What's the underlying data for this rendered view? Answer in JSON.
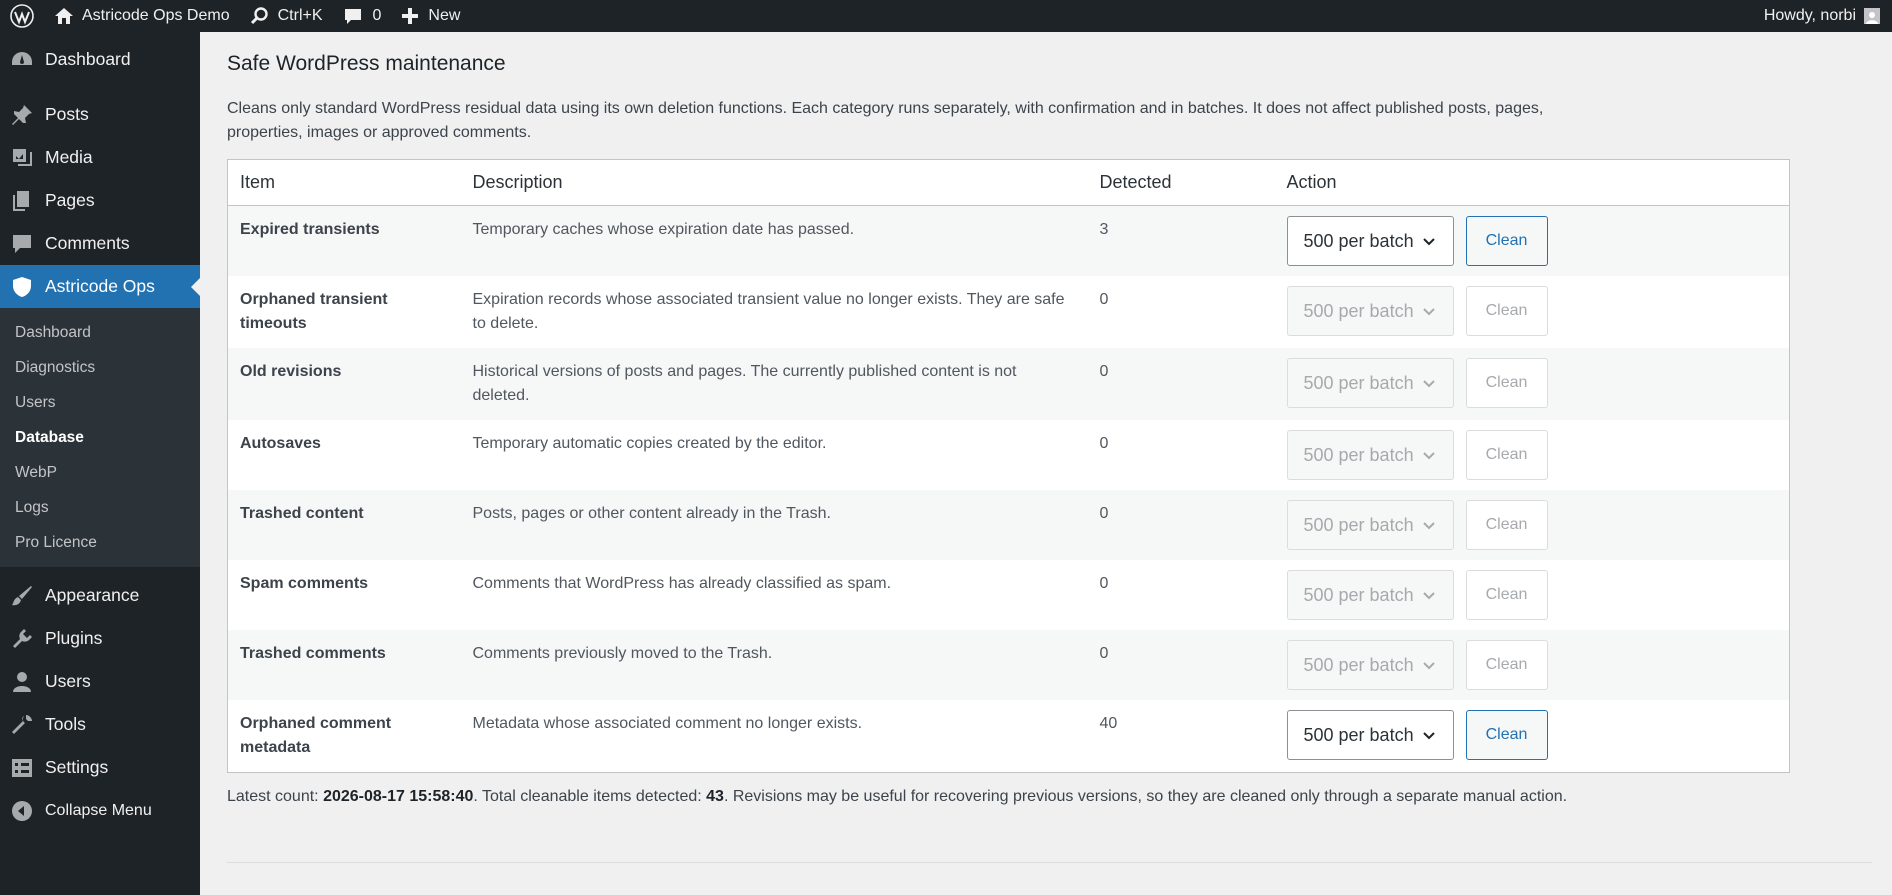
{
  "adminbar": {
    "site_name": "Astricode Ops Demo",
    "search_shortcut": "Ctrl+K",
    "comments_count": "0",
    "new_label": "New",
    "greeting": "Howdy, norbi"
  },
  "sidebar": {
    "top_items": [
      {
        "label": "Dashboard",
        "icon": "dashboard-icon"
      },
      {
        "label": "Posts",
        "icon": "pin-icon"
      },
      {
        "label": "Media",
        "icon": "media-icon"
      },
      {
        "label": "Pages",
        "icon": "pages-icon"
      },
      {
        "label": "Comments",
        "icon": "comments-icon"
      },
      {
        "label": "Astricode Ops",
        "icon": "shield-icon"
      }
    ],
    "submenu": [
      "Dashboard",
      "Diagnostics",
      "Users",
      "Database",
      "WebP",
      "Logs",
      "Pro Licence"
    ],
    "active_submenu": "Database",
    "bottom_items": [
      {
        "label": "Appearance",
        "icon": "brush-icon"
      },
      {
        "label": "Plugins",
        "icon": "plugin-icon"
      },
      {
        "label": "Users",
        "icon": "users-icon"
      },
      {
        "label": "Tools",
        "icon": "wrench-icon"
      },
      {
        "label": "Settings",
        "icon": "settings-icon"
      },
      {
        "label": "Collapse Menu",
        "icon": "collapse-icon"
      }
    ]
  },
  "main": {
    "title": "Safe WordPress maintenance",
    "intro": "Cleans only standard WordPress residual data using its own deletion functions. Each category runs separately, with confirmation and in batches. It does not affect published posts, pages, properties, images or approved comments.",
    "table": {
      "headers": [
        "Item",
        "Description",
        "Detected",
        "Action"
      ],
      "batch_label": "500 per batch",
      "clean_label": "Clean",
      "rows": [
        {
          "item": "Expired transients",
          "description": "Temporary caches whose expiration date has passed.",
          "detected": "3",
          "enabled": true
        },
        {
          "item": "Orphaned transient timeouts",
          "description": "Expiration records whose associated transient value no longer exists. They are safe to delete.",
          "detected": "0",
          "enabled": false
        },
        {
          "item": "Old revisions",
          "description": "Historical versions of posts and pages. The currently published content is not deleted.",
          "detected": "0",
          "enabled": false
        },
        {
          "item": "Autosaves",
          "description": "Temporary automatic copies created by the editor.",
          "detected": "0",
          "enabled": false
        },
        {
          "item": "Trashed content",
          "description": "Posts, pages or other content already in the Trash.",
          "detected": "0",
          "enabled": false
        },
        {
          "item": "Spam comments",
          "description": "Comments that WordPress has already classified as spam.",
          "detected": "0",
          "enabled": false
        },
        {
          "item": "Trashed comments",
          "description": "Comments previously moved to the Trash.",
          "detected": "0",
          "enabled": false
        },
        {
          "item": "Orphaned comment metadata",
          "description": "Metadata whose associated comment no longer exists.",
          "detected": "40",
          "enabled": true
        }
      ]
    },
    "footer": {
      "prefix": "Latest count: ",
      "timestamp": "2026-08-17 15:58:40",
      "middle": ". Total cleanable items detected: ",
      "total": "43",
      "suffix": ". Revisions may be useful for recovering previous versions, so they are cleaned only through a separate manual action."
    }
  },
  "colors": {
    "admin_dark": "#1d2327",
    "accent": "#2271b1",
    "submenu_bg": "#2c3338"
  }
}
